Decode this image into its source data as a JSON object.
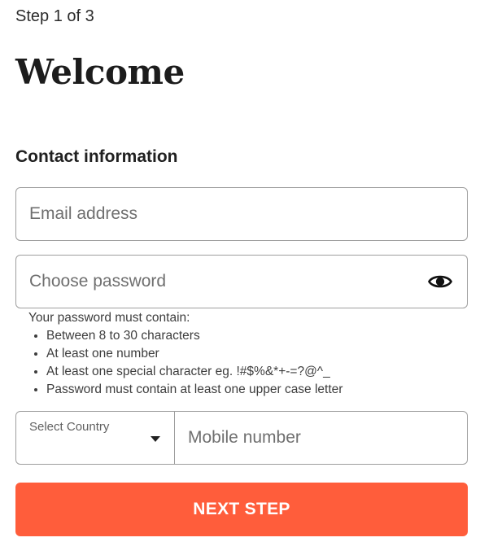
{
  "header": {
    "step": "Step 1 of 3",
    "title": "Welcome"
  },
  "contact": {
    "section_label": "Contact information",
    "email": {
      "placeholder": "Email address",
      "value": ""
    },
    "password": {
      "placeholder": "Choose password",
      "value": "",
      "toggle_icon": "eye-icon"
    },
    "password_rules": {
      "intro": "Your password must contain:",
      "items": [
        "Between 8 to 30 characters",
        "At least one number",
        "At least one special character eg. !#$%&*+-=?@^_",
        "Password must contain at least one upper case letter"
      ]
    },
    "country": {
      "label": "Select Country",
      "icon": "chevron-down-icon"
    },
    "mobile": {
      "placeholder": "Mobile number",
      "value": ""
    }
  },
  "actions": {
    "next_label": "NEXT STEP"
  },
  "colors": {
    "accent": "#ff5d3b",
    "border": "#9e9e9e",
    "text": "#212121"
  }
}
